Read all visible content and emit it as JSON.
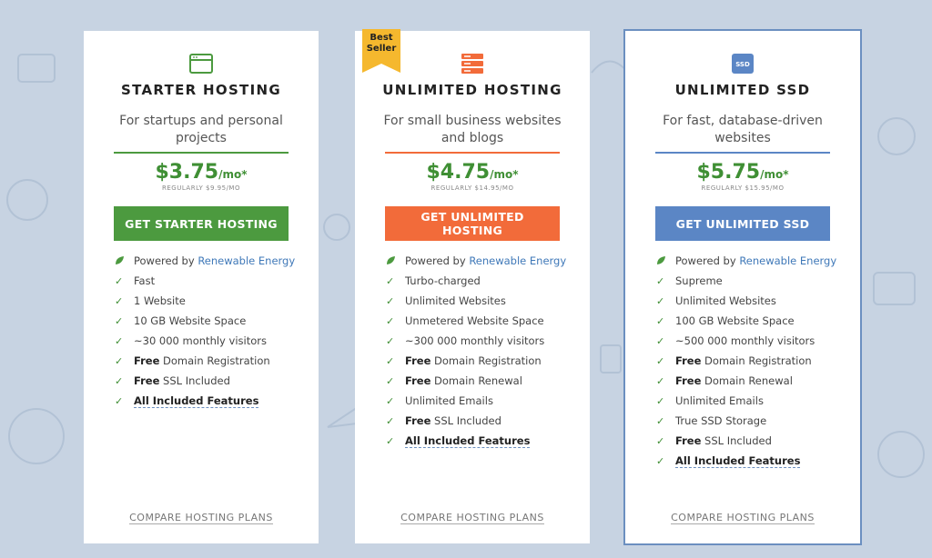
{
  "colors": {
    "background": "#c7d3e2",
    "green": "#4c9a3f",
    "orange": "#f26b3a",
    "blue": "#5b86c5",
    "ribbon": "#f5b82e"
  },
  "plans": [
    {
      "icon": "browser-window-icon",
      "title": "STARTER HOSTING",
      "description": "For startups and personal projects",
      "price_main": "$3.75",
      "price_unit": "/mo*",
      "regular": "REGULARLY $9.95/MO",
      "cta": "GET STARTER HOSTING",
      "features": [
        {
          "type": "renewable",
          "prefix": "Powered by ",
          "link": "Renewable Energy"
        },
        {
          "type": "text",
          "text": "Fast"
        },
        {
          "type": "text",
          "text": "1 Website"
        },
        {
          "type": "text",
          "text": "10 GB Website Space"
        },
        {
          "type": "text",
          "text": "~30 000 monthly visitors"
        },
        {
          "type": "bold",
          "bold": "Free",
          "text": " Domain Registration"
        },
        {
          "type": "bold",
          "bold": "Free",
          "text": " SSL Included"
        },
        {
          "type": "all",
          "text": "All Included Features"
        }
      ],
      "compare": "COMPARE HOSTING PLANS"
    },
    {
      "icon": "server-stack-icon",
      "badge": "Best Seller",
      "title": "UNLIMITED HOSTING",
      "description": "For small business websites and blogs",
      "price_main": "$4.75",
      "price_unit": "/mo*",
      "regular": "REGULARLY $14.95/MO",
      "cta": "GET UNLIMITED HOSTING",
      "features": [
        {
          "type": "renewable",
          "prefix": "Powered by ",
          "link": "Renewable Energy"
        },
        {
          "type": "text",
          "text": "Turbo-charged"
        },
        {
          "type": "text",
          "text": "Unlimited Websites"
        },
        {
          "type": "text",
          "text": "Unmetered Website Space"
        },
        {
          "type": "text",
          "text": "~300 000 monthly visitors"
        },
        {
          "type": "bold",
          "bold": "Free",
          "text": " Domain Registration"
        },
        {
          "type": "bold",
          "bold": "Free",
          "text": " Domain Renewal"
        },
        {
          "type": "text",
          "text": "Unlimited Emails"
        },
        {
          "type": "bold",
          "bold": "Free",
          "text": " SSL Included"
        },
        {
          "type": "all",
          "text": "All Included Features"
        }
      ],
      "compare": "COMPARE HOSTING PLANS"
    },
    {
      "icon": "ssd-chip-icon",
      "icon_label": "SSD",
      "title": "UNLIMITED SSD",
      "description": "For fast, database-driven websites",
      "price_main": "$5.75",
      "price_unit": "/mo*",
      "regular": "REGULARLY $15.95/MO",
      "cta": "GET UNLIMITED SSD",
      "features": [
        {
          "type": "renewable",
          "prefix": "Powered by ",
          "link": "Renewable Energy"
        },
        {
          "type": "text",
          "text": "Supreme"
        },
        {
          "type": "text",
          "text": "Unlimited Websites"
        },
        {
          "type": "text",
          "text": "100 GB Website Space"
        },
        {
          "type": "text",
          "text": "~500 000 monthly visitors"
        },
        {
          "type": "bold",
          "bold": "Free",
          "text": " Domain Registration"
        },
        {
          "type": "bold",
          "bold": "Free",
          "text": " Domain Renewal"
        },
        {
          "type": "text",
          "text": "Unlimited Emails"
        },
        {
          "type": "text",
          "text": "True SSD Storage"
        },
        {
          "type": "bold",
          "bold": "Free",
          "text": " SSL Included"
        },
        {
          "type": "all",
          "text": "All Included Features"
        }
      ],
      "compare": "COMPARE HOSTING PLANS"
    }
  ]
}
